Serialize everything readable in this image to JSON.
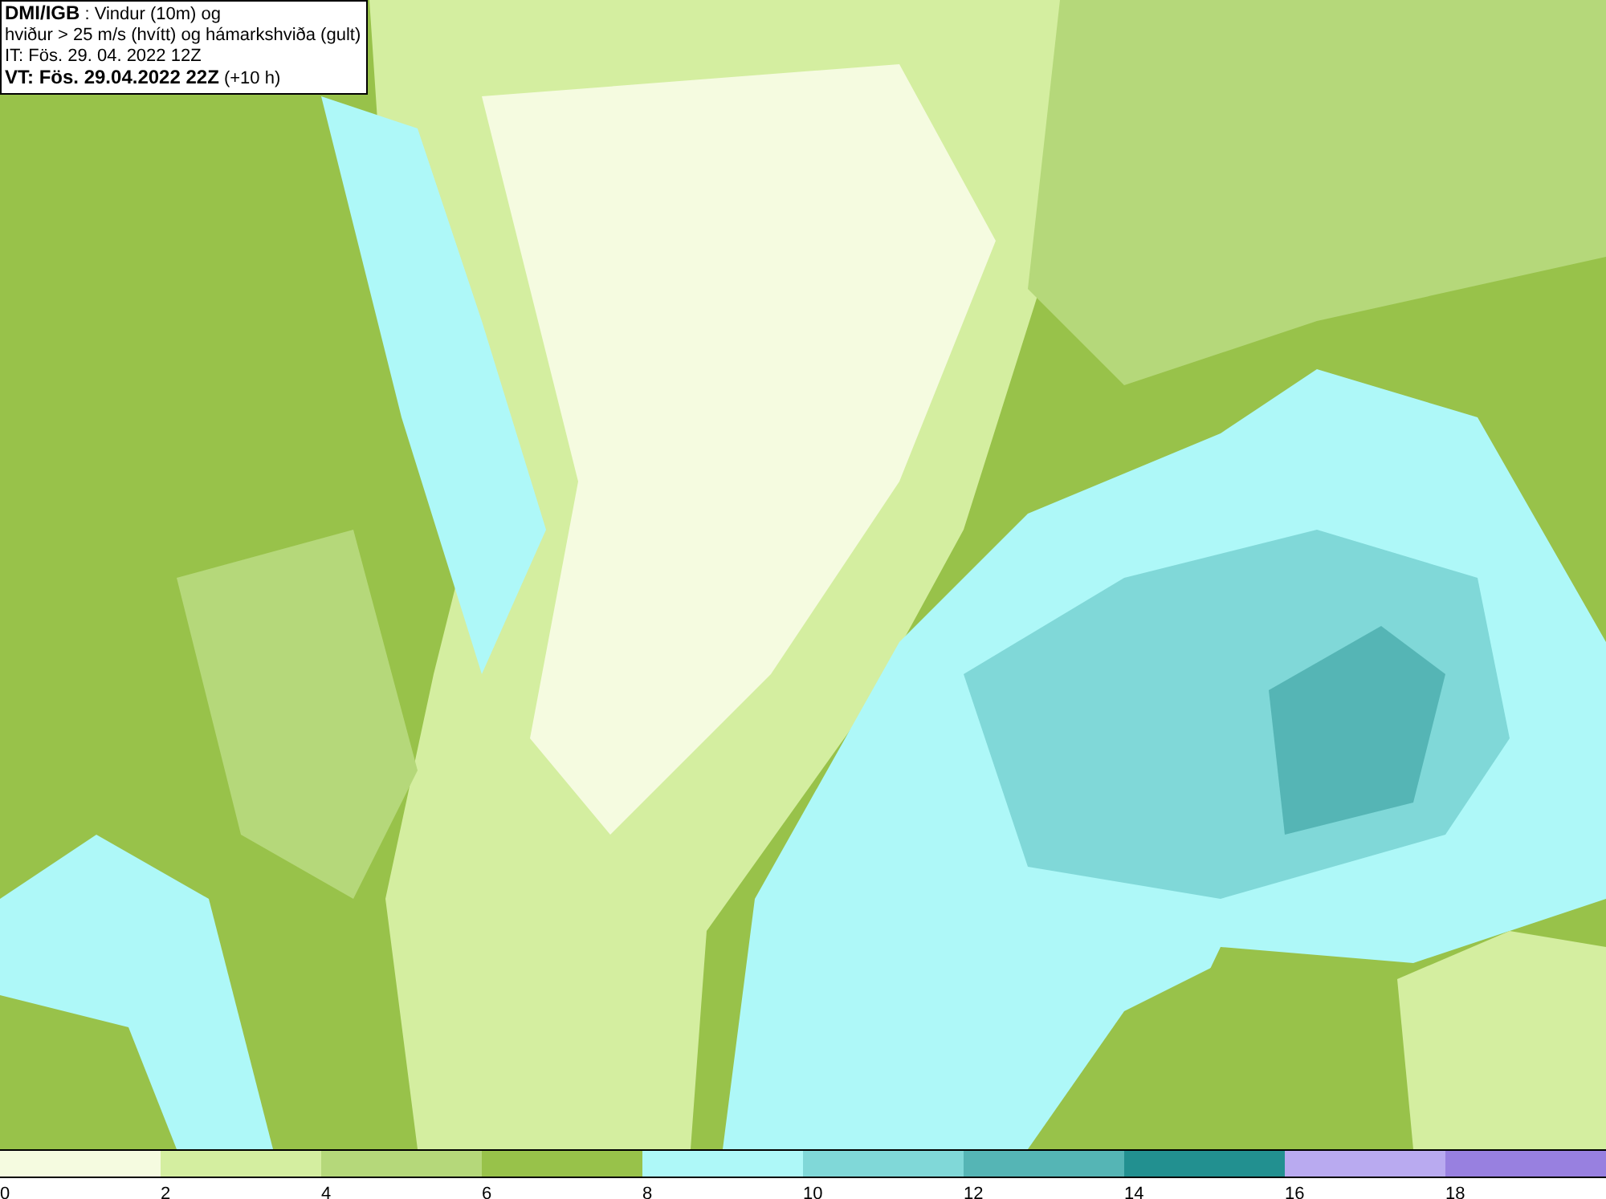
{
  "header": {
    "lines": [
      "**DMI/IGB** : Vindur (10m) og",
      "hviður > 25 m/s (hvítt) og hámarkshviða (gult)",
      "IT: Fös. 29. 04. 2022 12Z",
      "**VT: Fös. 29.04.2022 22Z** (+10 h)"
    ]
  },
  "legend": {
    "bins": [
      {
        "color": "#f5fbe0",
        "label": "0"
      },
      {
        "color": "#d4eea0",
        "label": "2"
      },
      {
        "color": "#b5d87a",
        "label": "4"
      },
      {
        "color": "#98c24a",
        "label": "6"
      },
      {
        "color": "#aef8f8",
        "label": "8"
      },
      {
        "color": "#80d8d8",
        "label": "10"
      },
      {
        "color": "#55b5b5",
        "label": "12"
      },
      {
        "color": "#229090",
        "label": "14"
      },
      {
        "color": "#b9aaf0",
        "label": "16"
      },
      {
        "color": "#9880e0",
        "label": "18"
      }
    ]
  }
}
